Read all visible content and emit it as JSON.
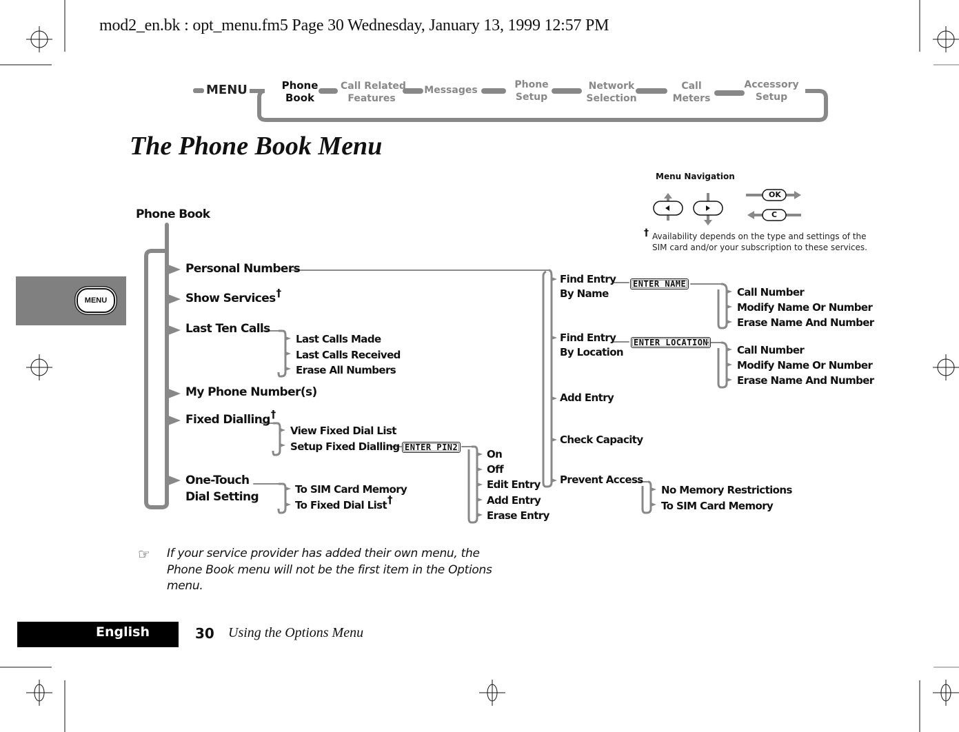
{
  "print_header": "mod2_en.bk : opt_menu.fm5  Page 30  Wednesday, January 13, 1999  12:57 PM",
  "nav_bar": {
    "menu_label": "MENU",
    "items": [
      {
        "line1": "Phone",
        "line2": "Book",
        "active": true
      },
      {
        "line1": "Call Related",
        "line2": "Features",
        "active": false
      },
      {
        "line1": "Messages",
        "line2": "",
        "active": false
      },
      {
        "line1": "Phone",
        "line2": "Setup",
        "active": false
      },
      {
        "line1": "Network",
        "line2": "Selection",
        "active": false
      },
      {
        "line1": "Call",
        "line2": "Meters",
        "active": false
      },
      {
        "line1": "Accessory",
        "line2": "Setup",
        "active": false
      }
    ]
  },
  "page_title": "The Phone Book Menu",
  "side_tab": {
    "button_label": "MENU"
  },
  "menu_navigation": {
    "title": "Menu Navigation",
    "keys": {
      "left": "◄",
      "right": "►",
      "ok": "OK",
      "clear": "C"
    },
    "footnote_mark": "†",
    "footnote_line1": "Availability depends on the type and settings of the",
    "footnote_line2": "SIM card and/or your subscription to these services."
  },
  "tree": {
    "root": "Phone Book",
    "dagger": "†",
    "level1": {
      "personal_numbers": "Personal Numbers",
      "show_services": "Show Services",
      "last_ten_calls": "Last Ten Calls",
      "my_phone_numbers": "My Phone Number(s)",
      "fixed_dialling": "Fixed Dialling",
      "one_touch_1": "One-Touch",
      "one_touch_2": "Dial Setting"
    },
    "last_ten_calls": [
      "Last Calls Made",
      "Last Calls Received",
      "Erase All Numbers"
    ],
    "fixed_dialling": [
      "View Fixed Dial List",
      "Setup Fixed Dialling"
    ],
    "enter_pin2": "ENTER PIN2",
    "pin2_options": [
      "On",
      "Off",
      "Edit Entry",
      "Add Entry",
      "Erase Entry"
    ],
    "one_touch": [
      "To SIM Card Memory",
      "To Fixed Dial List"
    ],
    "personal_numbers": {
      "find_by_name_1": "Find Entry",
      "find_by_name_2": "By Name",
      "enter_name": "ENTER NAME",
      "find_by_location_1": "Find Entry",
      "find_by_location_2": "By Location",
      "enter_location": "ENTER LOCATION",
      "add_entry": "Add Entry",
      "check_capacity": "Check Capacity",
      "prevent_access": "Prevent Access"
    },
    "name_options": [
      "Call Number",
      "Modify Name Or Number",
      "Erase Name And Number"
    ],
    "location_options": [
      "Call Number",
      "Modify Name Or Number",
      "Erase Name And Number"
    ],
    "prevent_access_options": [
      "No Memory Restrictions",
      "To SIM Card Memory"
    ]
  },
  "note": "If your service provider has added their own menu, the Phone Book menu will not be the first item in the Options menu.",
  "footer": {
    "language": "English",
    "page_number": "30",
    "section_title": "Using the Options Menu"
  }
}
